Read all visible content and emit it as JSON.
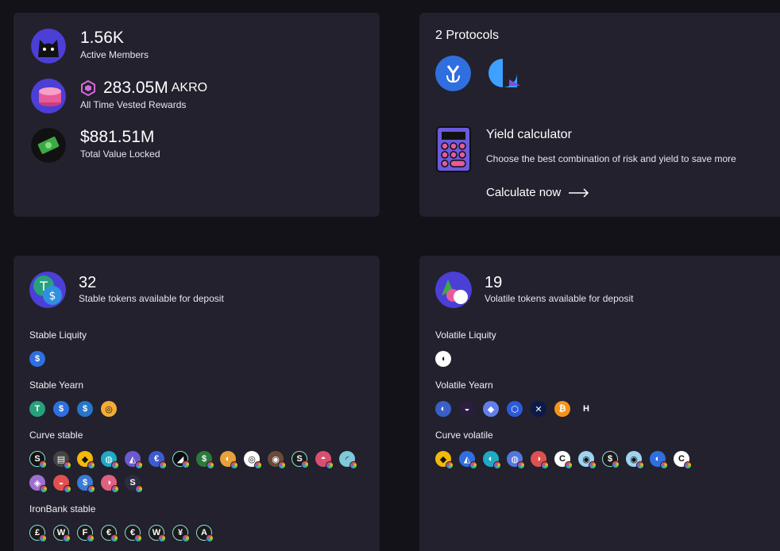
{
  "stats": [
    {
      "value": "1.56K",
      "unit": "",
      "label": "Active Members",
      "icon": "cat-icon"
    },
    {
      "value": "283.05M",
      "unit": "AKRO",
      "label": "All Time Vested Rewards",
      "icon": "coin-stack-icon"
    },
    {
      "value": "$881.51M",
      "unit": "",
      "label": "Total Value Locked",
      "icon": "money-icon"
    }
  ],
  "protocols": {
    "title": "2 Protocols",
    "items": [
      {
        "name": "yearn",
        "icon": "yearn-icon",
        "color": "#2f6fe0"
      },
      {
        "name": "liquity",
        "icon": "liquity-icon",
        "color": "#3ea0ff"
      }
    ],
    "calculator": {
      "title": "Yield calculator",
      "description": "Choose the best combination of risk and yield to save more",
      "link": "Calculate now"
    }
  },
  "stable": {
    "count": "32",
    "description": "Stable tokens available for deposit",
    "groups": [
      {
        "label": "Stable Liquity",
        "tokens": [
          {
            "glyph": "$",
            "color": "#2f6fe0"
          }
        ]
      },
      {
        "label": "Stable Yearn",
        "tokens": [
          {
            "glyph": "T",
            "color": "#26a17b"
          },
          {
            "glyph": "$",
            "color": "#2f6fe0"
          },
          {
            "glyph": "$",
            "color": "#2775ca"
          },
          {
            "glyph": "◎",
            "color": "#f5ac37"
          }
        ]
      },
      {
        "label": "Curve stable",
        "tokens": [
          {
            "glyph": "S",
            "color": "#111"
          },
          {
            "glyph": "▤",
            "color": "#444"
          },
          {
            "glyph": "◆",
            "color": "#f0b90b"
          },
          {
            "glyph": "◍",
            "color": "#1fa9c4"
          },
          {
            "glyph": "◭",
            "color": "#6a5acd"
          },
          {
            "glyph": "€",
            "color": "#3d5ccf"
          },
          {
            "glyph": "◢",
            "color": "#0d0d0d"
          },
          {
            "glyph": "$",
            "color": "#2b7a3d"
          },
          {
            "glyph": "◐",
            "color": "#e8a13a"
          },
          {
            "glyph": "◎",
            "color": "#fff"
          },
          {
            "glyph": "◉",
            "color": "#6b4a3a"
          },
          {
            "glyph": "S",
            "color": "#1a1a1a"
          },
          {
            "glyph": "◓",
            "color": "#d94f70"
          },
          {
            "glyph": "◜",
            "color": "#7ecad8"
          },
          {
            "glyph": "◈",
            "color": "#a070d0"
          },
          {
            "glyph": "◒",
            "color": "#e05050"
          },
          {
            "glyph": "$",
            "color": "#3a7bd5"
          },
          {
            "glyph": "◑",
            "color": "#e06080"
          },
          {
            "glyph": "S",
            "color": "#2c2c40"
          }
        ]
      },
      {
        "label": "IronBank stable",
        "tokens": [
          {
            "glyph": "£",
            "color": "#1a1a1a"
          },
          {
            "glyph": "W",
            "color": "#1a1a1a"
          },
          {
            "glyph": "F",
            "color": "#1a1a1a"
          },
          {
            "glyph": "€",
            "color": "#1a1a1a"
          },
          {
            "glyph": "€",
            "color": "#1a1a1a"
          },
          {
            "glyph": "W",
            "color": "#1a1a1a"
          },
          {
            "glyph": "¥",
            "color": "#1a1a1a"
          },
          {
            "glyph": "A",
            "color": "#1a1a1a"
          }
        ]
      }
    ]
  },
  "volatile": {
    "count": "19",
    "description": "Volatile tokens available for deposit",
    "groups": [
      {
        "label": "Volatile Liquity",
        "tokens": [
          {
            "glyph": "◖",
            "color": "#fff"
          }
        ]
      },
      {
        "label": "Volatile Yearn",
        "tokens": [
          {
            "glyph": "◐",
            "color": "#3b5fc6"
          },
          {
            "glyph": "◒",
            "color": "#2b1d3d"
          },
          {
            "glyph": "◆",
            "color": "#627eea"
          },
          {
            "glyph": "⬡",
            "color": "#2a5ada"
          },
          {
            "glyph": "✕",
            "color": "#0b1a4a"
          },
          {
            "glyph": "₿",
            "color": "#f7931a"
          },
          {
            "glyph": "H",
            "color": "#22212d"
          }
        ]
      },
      {
        "label": "Curve volatile",
        "tokens": [
          {
            "glyph": "◆",
            "color": "#f0b90b"
          },
          {
            "glyph": "◭",
            "color": "#2f6fe0"
          },
          {
            "glyph": "◐",
            "color": "#1fa9c4"
          },
          {
            "glyph": "◍",
            "color": "#5577dd"
          },
          {
            "glyph": "◑",
            "color": "#e05050"
          },
          {
            "glyph": "C",
            "color": "#fff"
          },
          {
            "glyph": "◉",
            "color": "#9fd3f0"
          },
          {
            "glyph": "$",
            "color": "#1a1a1a"
          },
          {
            "glyph": "◉",
            "color": "#9fd3f0"
          },
          {
            "glyph": "◐",
            "color": "#2f6fe0"
          },
          {
            "glyph": "C",
            "color": "#fff"
          }
        ]
      }
    ]
  }
}
